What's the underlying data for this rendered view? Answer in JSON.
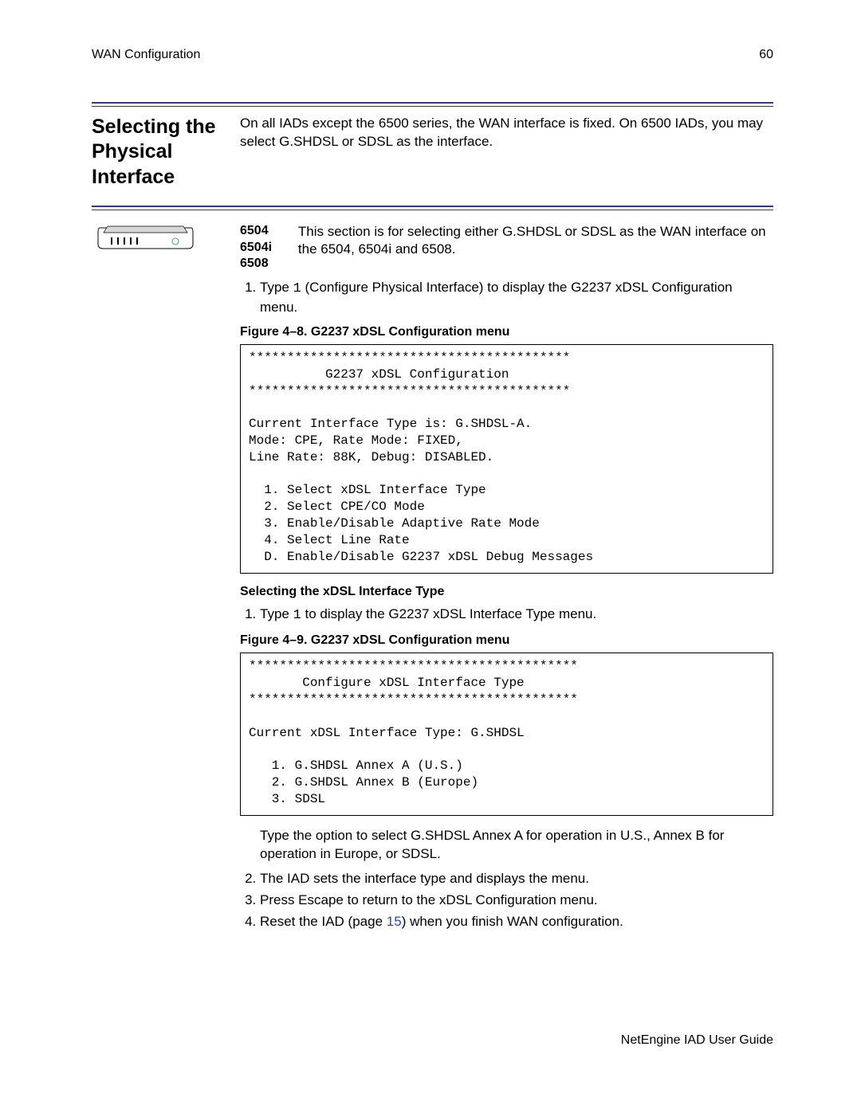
{
  "header": {
    "left": "WAN Configuration",
    "right": "60"
  },
  "section_heading": "Selecting the Physical Interface",
  "intro_text": "On all IADs except the 6500 series, the WAN interface is fixed. On 6500 IADs, you may select G.SHDSL or SDSL as the interface.",
  "device_models": [
    "6504",
    "6504i",
    "6508"
  ],
  "device_desc": "This section is for selecting either G.SHDSL or SDSL as the WAN interface on the 6504, 6504i and 6508.",
  "step1_prefix": "Type ",
  "step1_key": "1",
  "step1_suffix": " (Configure Physical Interface) to display the G2237 xDSL Configuration menu.",
  "figure48_caption": "Figure 4–8.  G2237 xDSL Configuration menu",
  "figure48_code": "******************************************\n          G2237 xDSL Configuration\n******************************************\n\nCurrent Interface Type is: G.SHDSL-A.\nMode: CPE, Rate Mode: FIXED,\nLine Rate: 88K, Debug: DISABLED.\n\n  1. Select xDSL Interface Type\n  2. Select CPE/CO Mode\n  3. Enable/Disable Adaptive Rate Mode\n  4. Select Line Rate\n  D. Enable/Disable G2237 xDSL Debug Messages",
  "sub_heading": "Selecting the xDSL Interface Type",
  "sub_step_prefix": "Type ",
  "sub_step_key": "1",
  "sub_step_suffix": " to display the G2237 xDSL Interface Type menu.",
  "figure49_caption": "Figure 4–9.  G2237 xDSL Configuration menu",
  "figure49_code": "*******************************************\n       Configure xDSL Interface Type\n*******************************************\n\nCurrent xDSL Interface Type: G.SHDSL\n\n   1. G.SHDSL Annex A (U.S.)\n   2. G.SHDSL Annex B (Europe)\n   3. SDSL",
  "post_text": "Type the option to select G.SHDSL Annex A for operation in U.S., Annex B for operation in Europe, or SDSL.",
  "trailing_steps": {
    "s2": "The IAD sets the interface type and displays the menu.",
    "s3": "Press Escape to return to the xDSL Configuration menu.",
    "s4_a": "Reset the IAD (page ",
    "s4_link": "15",
    "s4_b": ") when you finish WAN configuration."
  },
  "footer": "NetEngine IAD User Guide"
}
